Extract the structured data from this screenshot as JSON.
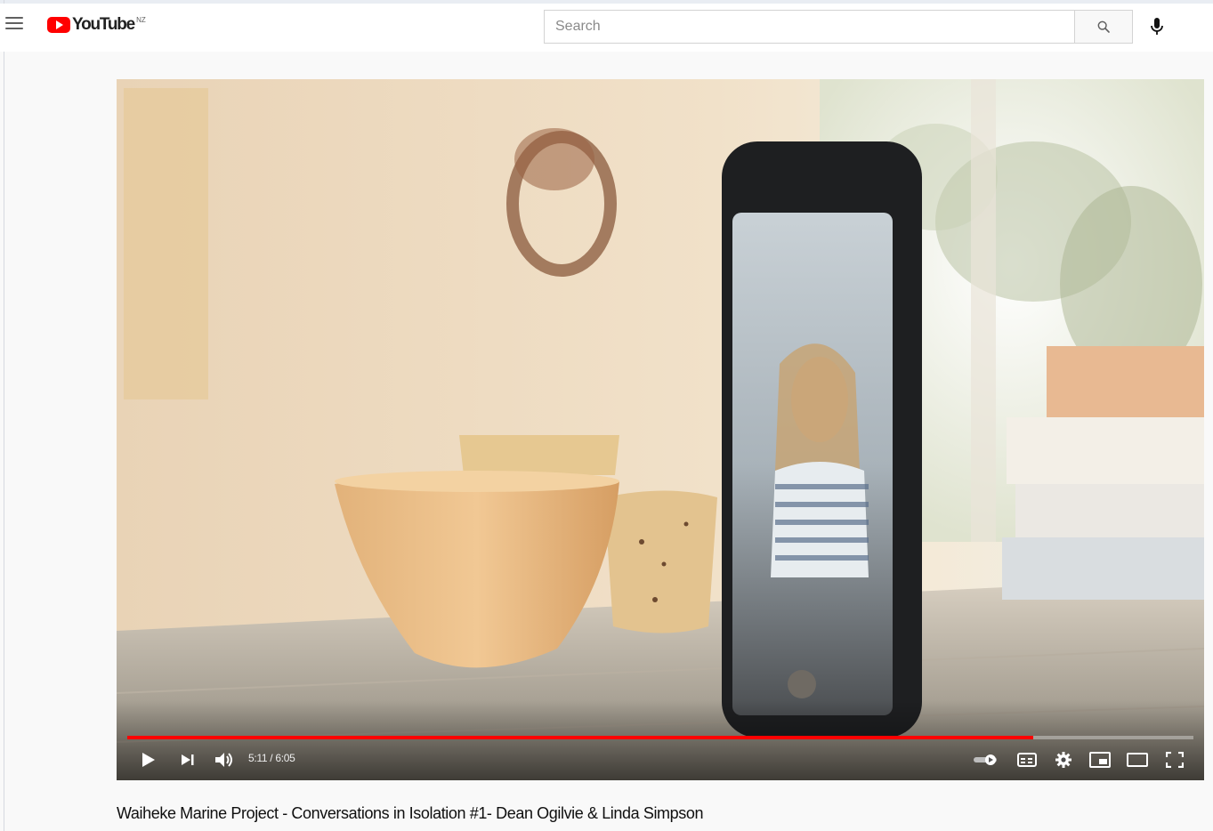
{
  "masthead": {
    "logo_text": "YouTube",
    "country_code": "NZ",
    "search": {
      "placeholder": "Search",
      "value": ""
    },
    "icons": [
      "menu-icon",
      "youtube-logo-icon",
      "search-icon",
      "microphone-icon"
    ]
  },
  "player": {
    "time_display": "5:11 / 6:05",
    "progress_played_fraction": 0.85,
    "state": "paused",
    "icons": [
      "play-icon",
      "next-icon",
      "volume-icon",
      "autoplay-toggle-icon",
      "subtitles-icon",
      "settings-icon",
      "miniplayer-icon",
      "theater-mode-icon",
      "fullscreen-icon"
    ]
  },
  "video": {
    "title": "Waiheke Marine Project - Conversations in Isolation #1- Dean Ogilvie & Linda Simpson"
  },
  "colors": {
    "brand_red": "#ff0000",
    "progress_red": "#ff0000",
    "masthead_bg": "#ffffff",
    "page_bg": "#f9f9f9"
  }
}
